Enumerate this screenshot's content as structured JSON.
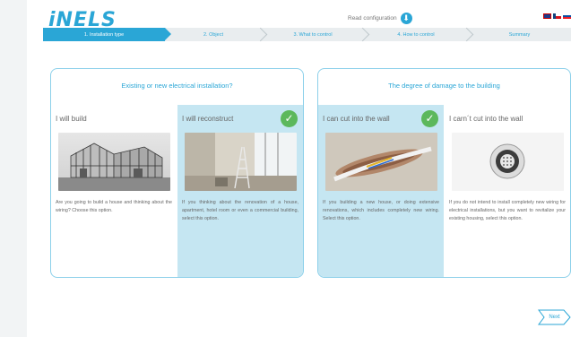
{
  "header": {
    "logo": "iNELS",
    "read_config_label": "Read configuration",
    "read_config_icon": "download-circle-icon",
    "flags": [
      "uk-flag-icon",
      "cz-flag-icon",
      "sk-flag-icon"
    ]
  },
  "steps": [
    {
      "label": "1. Installation type",
      "active": true
    },
    {
      "label": "2. Object",
      "active": false
    },
    {
      "label": "3. What to control",
      "active": false
    },
    {
      "label": "4. How to control",
      "active": false
    },
    {
      "label": "Summary",
      "active": false
    }
  ],
  "panels": [
    {
      "title": "Existing or new electrical installation?",
      "options": [
        {
          "title": "I will build",
          "description": "Are you going to build a house and thinking about the wiring? Choose this option.",
          "selected": false,
          "image": "house-construction-photo"
        },
        {
          "title": "I will reconstruct",
          "description": "If you thinking about the renovation of a house, apartment, hotel room or even a commercial building, select this option.",
          "selected": true,
          "image": "room-renovation-photo"
        }
      ]
    },
    {
      "title": "The degree of damage to the building",
      "options": [
        {
          "title": "I can cut into the wall",
          "description": "If you building a new house, or doing extensive renovations, which includes completely new wiring. Select this option.",
          "selected": true,
          "image": "wall-cable-photo"
        },
        {
          "title": "I carn´t cut into the wall",
          "description": "If you do not intend to install completely new wiring for electrical installations, but you want to revitalize your existing housing, select this option.",
          "selected": false,
          "image": "wireless-device-photo"
        }
      ]
    }
  ],
  "next_label": "Next",
  "colors": {
    "accent": "#2aa6d6",
    "selected_bg": "#c5e6f2",
    "check": "#5cb85c",
    "panel_border": "#8cd0ea"
  }
}
